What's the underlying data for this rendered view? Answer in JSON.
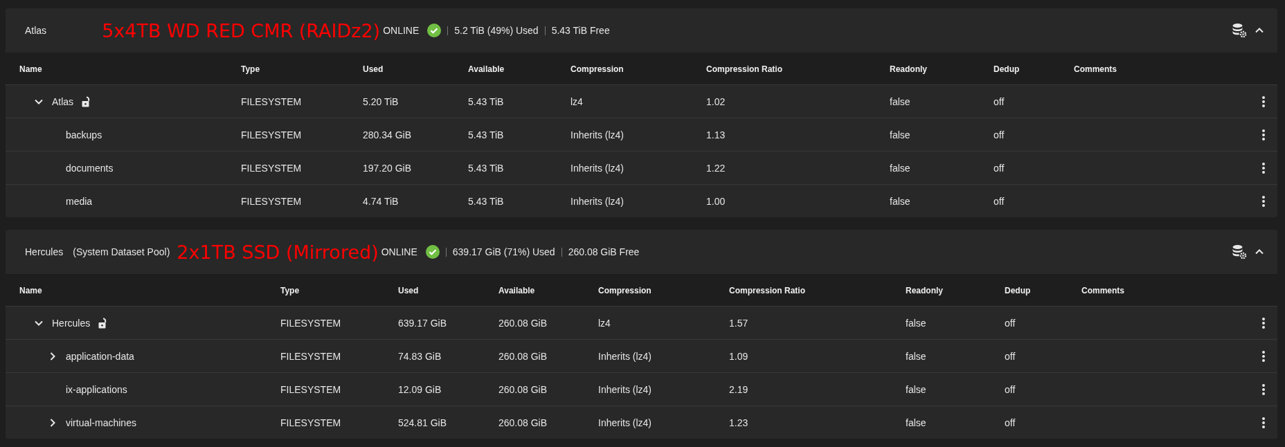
{
  "pools": [
    {
      "name": "Atlas",
      "annotation": "5x4TB WD RED CMR (RAIDz2)",
      "status": "ONLINE",
      "healthy": true,
      "used": "5.2 TiB (49%) Used",
      "free": "5.43 TiB Free",
      "expanded": true,
      "columns": [
        "Name",
        "Type",
        "Used",
        "Available",
        "Compression",
        "Compression Ratio",
        "Readonly",
        "Dedup",
        "Comments"
      ],
      "datasets": [
        {
          "name": "Atlas",
          "type": "FILESYSTEM",
          "used": "5.20 TiB",
          "available": "5.43 TiB",
          "compression": "lz4",
          "ratio": "1.02",
          "readonly": "false",
          "dedup": "off",
          "locked": false,
          "expanded": true,
          "children": [
            {
              "name": "backups",
              "type": "FILESYSTEM",
              "used": "280.34 GiB",
              "available": "5.43 TiB",
              "compression": "Inherits (lz4)",
              "ratio": "1.13",
              "readonly": "false",
              "dedup": "off"
            },
            {
              "name": "documents",
              "type": "FILESYSTEM",
              "used": "197.20 GiB",
              "available": "5.43 TiB",
              "compression": "Inherits (lz4)",
              "ratio": "1.22",
              "readonly": "false",
              "dedup": "off"
            },
            {
              "name": "media",
              "type": "FILESYSTEM",
              "used": "4.74 TiB",
              "available": "5.43 TiB",
              "compression": "Inherits (lz4)",
              "ratio": "1.00",
              "readonly": "false",
              "dedup": "off"
            }
          ]
        }
      ]
    },
    {
      "name": "Hercules",
      "subtitle": "(System Dataset Pool)",
      "annotation": "2x1TB SSD (Mirrored)",
      "status": "ONLINE",
      "healthy": true,
      "used": "639.17 GiB (71%) Used",
      "free": "260.08 GiB Free",
      "expanded": true,
      "columns": [
        "Name",
        "Type",
        "Used",
        "Available",
        "Compression",
        "Compression Ratio",
        "Readonly",
        "Dedup",
        "Comments"
      ],
      "datasets": [
        {
          "name": "Hercules",
          "type": "FILESYSTEM",
          "used": "639.17 GiB",
          "available": "260.08 GiB",
          "compression": "lz4",
          "ratio": "1.57",
          "readonly": "false",
          "dedup": "off",
          "locked": false,
          "expanded": true,
          "children": [
            {
              "name": "application-data",
              "type": "FILESYSTEM",
              "used": "74.83 GiB",
              "available": "260.08 GiB",
              "compression": "Inherits (lz4)",
              "ratio": "1.09",
              "readonly": "false",
              "dedup": "off",
              "expanded": false
            },
            {
              "name": "ix-applications",
              "type": "FILESYSTEM",
              "used": "12.09 GiB",
              "available": "260.08 GiB",
              "compression": "Inherits (lz4)",
              "ratio": "2.19",
              "readonly": "false",
              "dedup": "off"
            },
            {
              "name": "virtual-machines",
              "type": "FILESYSTEM",
              "used": "524.81 GiB",
              "available": "260.08 GiB",
              "compression": "Inherits (lz4)",
              "ratio": "1.23",
              "readonly": "false",
              "dedup": "off",
              "expanded": false
            }
          ]
        }
      ]
    }
  ]
}
